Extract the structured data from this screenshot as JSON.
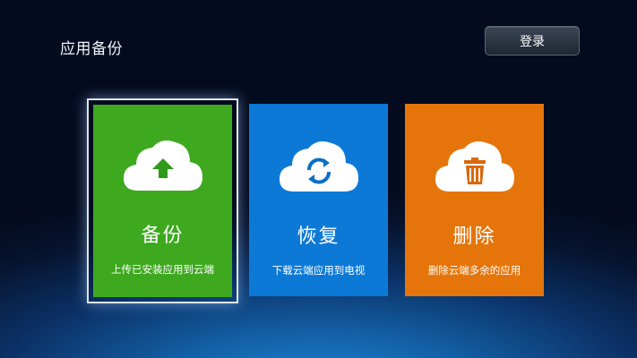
{
  "header": {
    "title": "应用备份",
    "login_label": "登录"
  },
  "cards": [
    {
      "title": "备份",
      "desc": "上传已安装应用到云端",
      "icon": "cloud-upload-icon",
      "color": "#3ea91f",
      "focused": true
    },
    {
      "title": "恢复",
      "desc": "下载云端应用到电视",
      "icon": "cloud-sync-icon",
      "color": "#0d79d7",
      "focused": false
    },
    {
      "title": "删除",
      "desc": "删除云端多余的应用",
      "icon": "cloud-trash-icon",
      "color": "#e5750a",
      "focused": false
    }
  ]
}
